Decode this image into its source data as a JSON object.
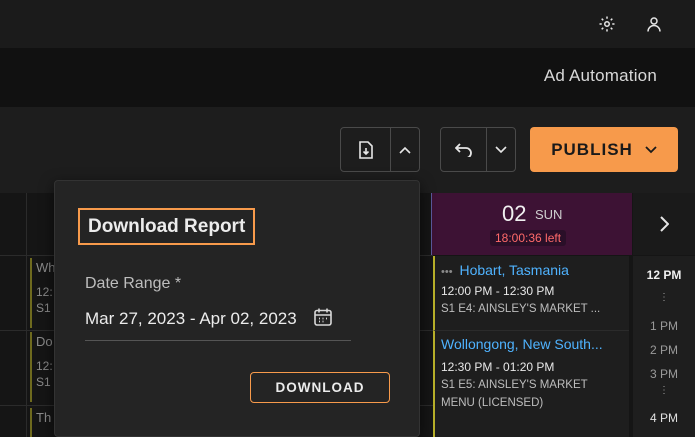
{
  "nav": {
    "title": "Ad Automation"
  },
  "toolbar": {
    "publish_label": "PUBLISH"
  },
  "icons": {
    "settings": "gear-icon",
    "user": "user-icon",
    "report": "file-download-icon",
    "undo": "undo-icon",
    "expand": "chevron-icon"
  },
  "colors": {
    "accent": "#f79a4b",
    "link": "#4fb3ff",
    "danger": "#ff6a6a",
    "day_header_bg": "#3d1234"
  },
  "calendar": {
    "day_number": "02",
    "day_name": "SUN",
    "time_left": "18:00:36 left",
    "left_column_fragments": [
      "Wh",
      "12:",
      "S1",
      "Do",
      "12:",
      "S1",
      "Th"
    ],
    "events": [
      {
        "title": "Hobart, Tasmania",
        "time": "12:00 PM - 12:30 PM",
        "desc": "S1 E4: AINSLEY'S MARKET ..."
      },
      {
        "title": "Wollongong, New South...",
        "time": "12:30 PM - 01:20 PM",
        "desc_line1": "S1 E5: AINSLEY'S MARKET",
        "desc_line2": "MENU (LICENSED)"
      }
    ],
    "time_labels": [
      "12 PM",
      "1 PM",
      "2 PM",
      "3 PM",
      "4 PM"
    ]
  },
  "report_popup": {
    "title": "Download Report",
    "date_range_label": "Date Range *",
    "date_range_value": "Mar 27, 2023 - Apr 02, 2023",
    "download_label": "DOWNLOAD"
  }
}
